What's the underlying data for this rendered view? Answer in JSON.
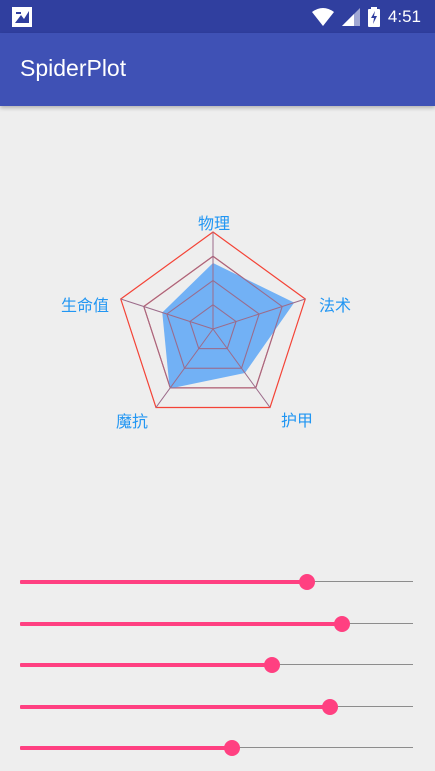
{
  "status_bar": {
    "time": "4:51",
    "icons": [
      "app-notification-icon",
      "wifi-icon",
      "signal-icon",
      "battery-charging-icon"
    ]
  },
  "app_bar": {
    "title": "SpiderPlot"
  },
  "radar": {
    "labels": [
      "物理",
      "法术",
      "护甲",
      "魔抗",
      "生命值"
    ],
    "values": [
      0.68,
      0.88,
      0.56,
      0.76,
      0.55
    ],
    "grid_levels": 4,
    "colors": {
      "grid_outer": "#f44336",
      "grid_inner": "#9c6b8a",
      "fill": "#64aaf5",
      "label": "#2196f3"
    }
  },
  "sliders": [
    {
      "value": 0.73
    },
    {
      "value": 0.82
    },
    {
      "value": 0.64
    },
    {
      "value": 0.79
    },
    {
      "value": 0.54
    }
  ],
  "colors": {
    "status_bar": "#303f9f",
    "app_bar": "#3f51b5",
    "accent": "#ff4081",
    "track": "#8c8c8c",
    "background": "#eeeeee"
  }
}
